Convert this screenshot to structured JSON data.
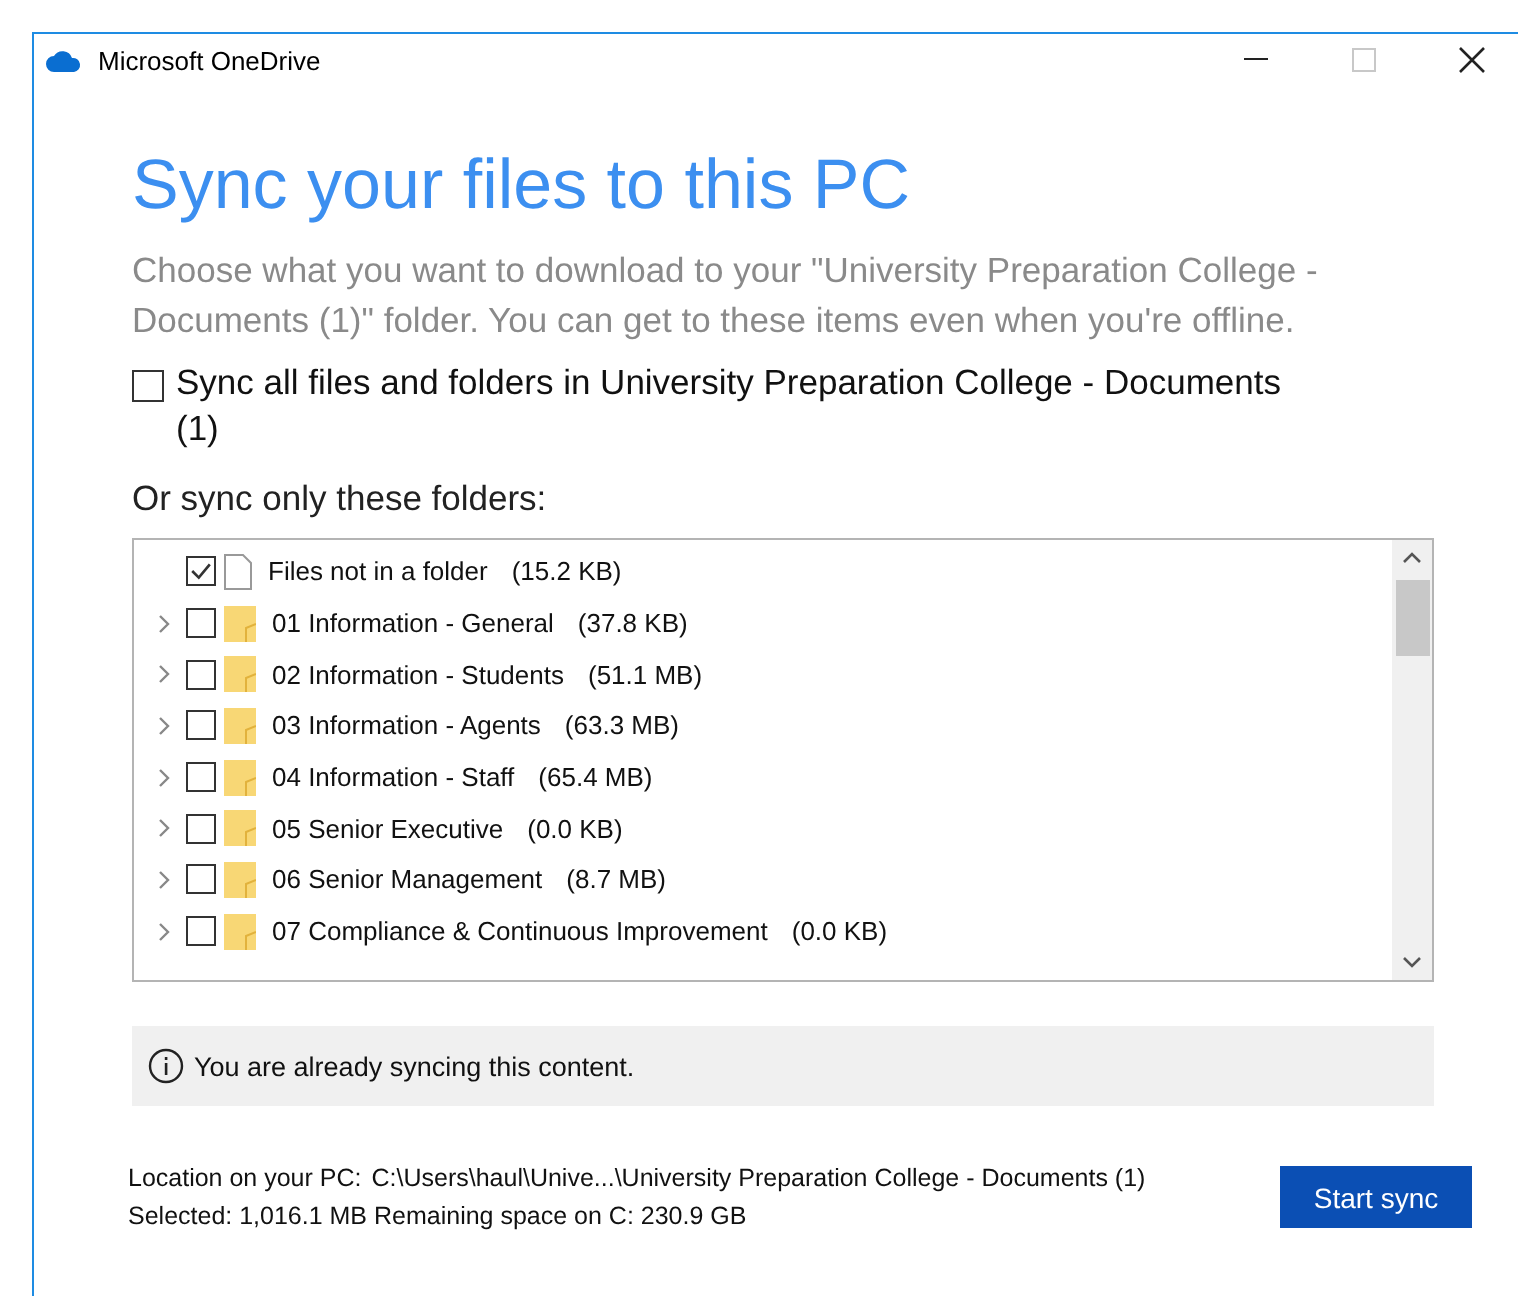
{
  "window": {
    "title": "Microsoft OneDrive",
    "maximize_disabled": true
  },
  "heading": "Sync your files to this PC",
  "description": "Choose what you want to download to your \"University Preparation College - Documents (1)\" folder. You can get to these items even when you're offline.",
  "sync_all": {
    "label": "Sync all files and folders in University Preparation College - Documents (1)",
    "checked": false
  },
  "folders_label": "Or sync only these folders:",
  "tree": [
    {
      "kind": "file",
      "name": "Files not in a folder",
      "size": "(15.2 KB)",
      "checked": true,
      "expandable": false
    },
    {
      "kind": "folder",
      "name": "01 Information - General",
      "size": "(37.8 KB)",
      "checked": false,
      "expandable": true
    },
    {
      "kind": "folder",
      "name": "02 Information - Students",
      "size": "(51.1 MB)",
      "checked": false,
      "expandable": true
    },
    {
      "kind": "folder",
      "name": "03 Information - Agents",
      "size": "(63.3 MB)",
      "checked": false,
      "expandable": true
    },
    {
      "kind": "folder",
      "name": "04 Information - Staff",
      "size": "(65.4 MB)",
      "checked": false,
      "expandable": true
    },
    {
      "kind": "folder",
      "name": "05 Senior Executive",
      "size": "(0.0 KB)",
      "checked": false,
      "expandable": true
    },
    {
      "kind": "folder",
      "name": "06 Senior Management",
      "size": "(8.7 MB)",
      "checked": false,
      "expandable": true
    },
    {
      "kind": "folder",
      "name": "07 Compliance & Continuous Improvement",
      "size": "(0.0 KB)",
      "checked": false,
      "expandable": true
    }
  ],
  "info": "You are already syncing this content.",
  "location_label": "Location on your PC:",
  "location_path": "C:\\Users\\haul\\Unive...\\University Preparation College - Documents (1)",
  "selected": "Selected: 1,016.1 MB Remaining space on C: 230.9 GB",
  "start_button": "Start sync"
}
